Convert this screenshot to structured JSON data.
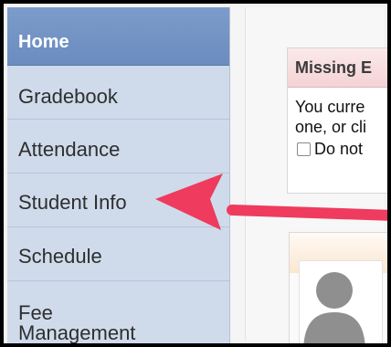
{
  "sidebar": {
    "items": [
      {
        "label": "Home"
      },
      {
        "label": "Gradebook"
      },
      {
        "label": "Attendance"
      },
      {
        "label": "Student Info"
      },
      {
        "label": "Schedule"
      },
      {
        "label": "Fee Management"
      }
    ]
  },
  "alert": {
    "title": "Missing E",
    "line1": "You curre",
    "line2": "one, or cli",
    "checkbox_label": "Do not"
  },
  "colors": {
    "sidebar_bg": "#cfdbeb",
    "home_bg": "#6a8cbf",
    "arrow": "#ee3b5e",
    "alert_header": "#f4d3d5"
  },
  "icons": [
    "user-avatar-icon",
    "annotation-arrow-icon"
  ]
}
